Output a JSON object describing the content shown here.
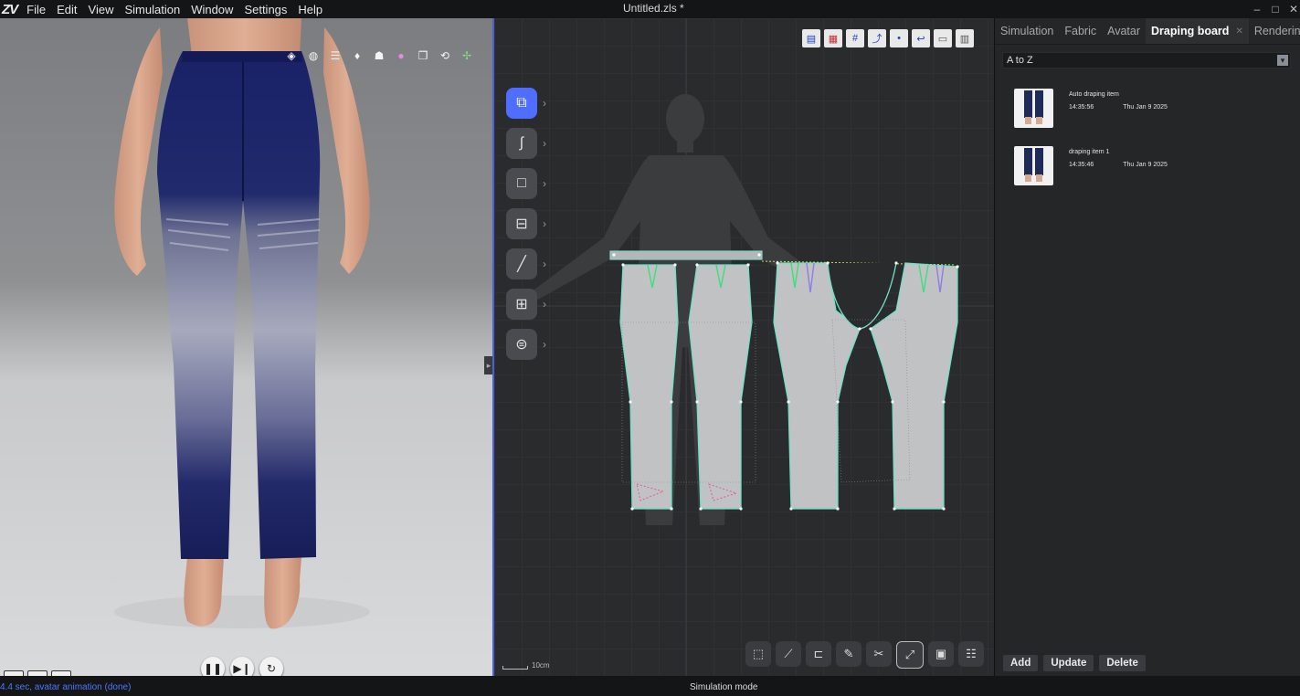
{
  "app": {
    "logo": "ZV",
    "menu": [
      "File",
      "Edit",
      "View",
      "Simulation",
      "Window",
      "Settings",
      "Help"
    ],
    "document_title": "Untitled.zls *",
    "window_controls": [
      "–",
      "□",
      "✕"
    ]
  },
  "viewport3d": {
    "top_icons": [
      "display-icon",
      "wireframe-icon",
      "layers-icon",
      "avatar-icon",
      "avatar-group-icon",
      "color-icon",
      "copy-icon",
      "reset-icon",
      "axis-icon"
    ],
    "playback": [
      "pause-icon",
      "step-icon",
      "reset-icon"
    ],
    "bottom_tools": [
      "image-icon",
      "zoom-image-icon",
      "camera-icon"
    ],
    "garment_color": "#1d2566"
  },
  "pattern2d": {
    "scale_label": "10cm",
    "top_toolbar": [
      "sheet-icon",
      "grid-color-icon",
      "grid-eye-icon",
      "seam-eye-icon",
      "point-eye-icon",
      "undo-eye-icon",
      "print-icon",
      "view-icon"
    ],
    "side_tools": [
      "transform-pattern-icon",
      "curve-icon",
      "rectangle-icon",
      "sewing-icon",
      "line-tool-icon",
      "texture-icon",
      "measure-icon"
    ],
    "bottom_tools": [
      "select-icon",
      "edit-point-icon",
      "sew-icon",
      "pin-icon",
      "cut-icon",
      "segment-icon",
      "image-icon",
      "list-icon"
    ]
  },
  "rightpanel": {
    "tabs": [
      {
        "label": "Simulation",
        "active": false
      },
      {
        "label": "Fabric",
        "active": false
      },
      {
        "label": "Avatar",
        "active": false
      },
      {
        "label": "Draping board",
        "active": true
      },
      {
        "label": "Rendering",
        "active": false
      }
    ],
    "sort": "A to Z",
    "items": [
      {
        "name": "Auto draping item",
        "time": "14:35:56",
        "date": "Thu Jan 9 2025"
      },
      {
        "name": "draping item 1",
        "time": "14:35:46",
        "date": "Thu Jan 9 2025"
      }
    ],
    "buttons": {
      "add": "Add",
      "update": "Update",
      "delete": "Delete"
    }
  },
  "status": {
    "left": "4.4 sec, avatar animation (done)",
    "mode": "Simulation mode"
  }
}
